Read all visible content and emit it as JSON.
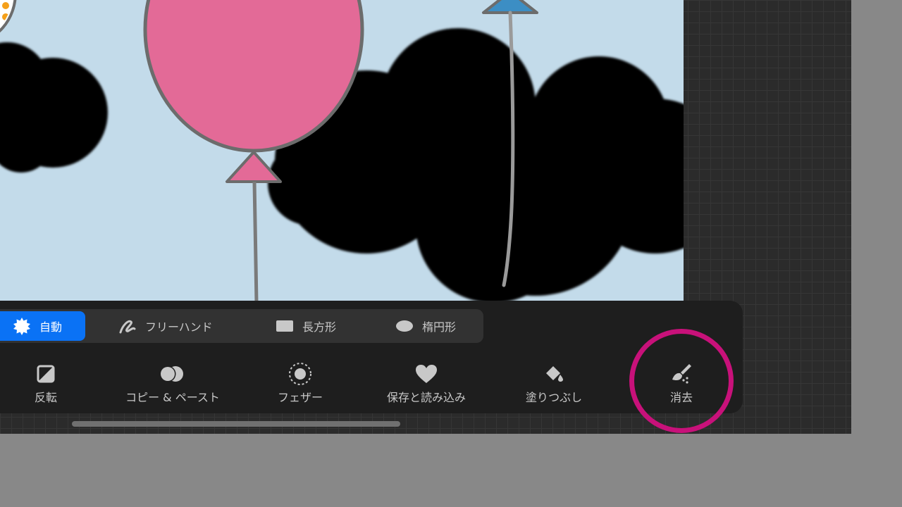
{
  "colors": {
    "sky": "#c3dbea",
    "accent_blue": "#0a72f5",
    "balloon_pink": "#e36a97",
    "balloon_blue": "#3c8ec4",
    "highlight_magenta": "#c8117a",
    "panel_bg": "#1e1e1e",
    "mode_bar_bg": "#323232",
    "text_muted": "#c8c8c8"
  },
  "selection_modes": [
    {
      "label": "自動",
      "icon": "auto-select-icon",
      "active": true
    },
    {
      "label": "フリーハンド",
      "icon": "freehand-icon",
      "active": false
    },
    {
      "label": "長方形",
      "icon": "rectangle-icon",
      "active": false
    },
    {
      "label": "楕円形",
      "icon": "ellipse-icon",
      "active": false
    }
  ],
  "tools": [
    {
      "label": "反転",
      "icon": "invert-icon"
    },
    {
      "label": "コピー & ペースト",
      "icon": "copy-paste-icon"
    },
    {
      "label": "フェザー",
      "icon": "feather-icon"
    },
    {
      "label": "保存と読み込み",
      "icon": "heart-icon"
    },
    {
      "label": "塗りつぶし",
      "icon": "fill-bucket-icon"
    },
    {
      "label": "消去",
      "icon": "brush-clear-icon",
      "highlighted": true
    }
  ]
}
